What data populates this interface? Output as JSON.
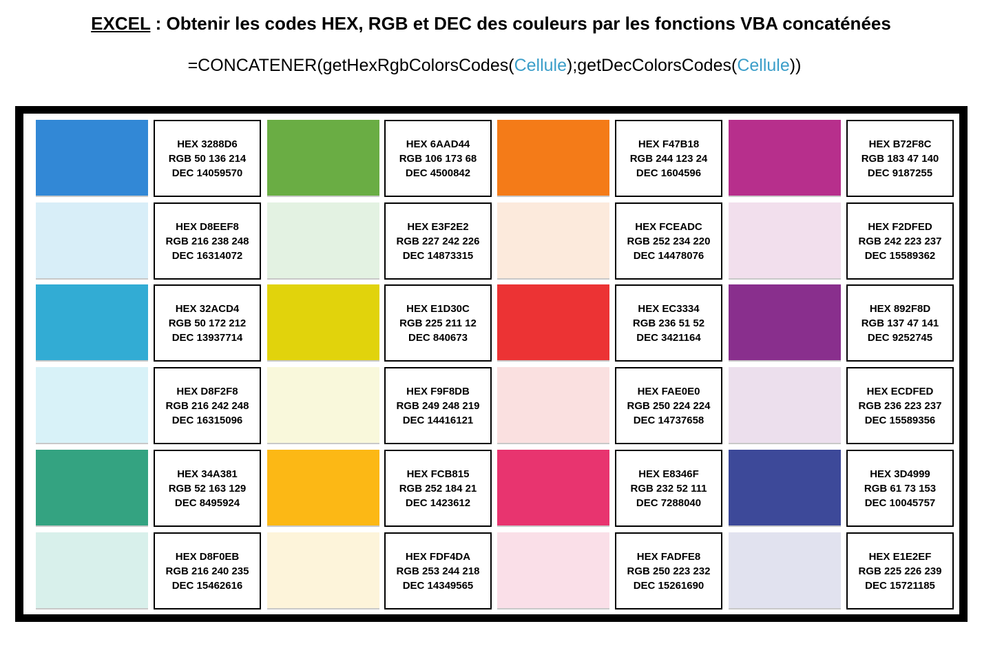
{
  "header": {
    "title_excel": "EXCEL",
    "title_rest": " : Obtenir les codes HEX, RGB et DEC des couleurs par les fonctions VBA concaténées"
  },
  "formula": {
    "part1": "=CONCATENER(getHexRgbColorsCodes(",
    "arg1": "Cellule",
    "part2": ");getDecColorsCodes(",
    "arg2": "Cellule",
    "part3": "))",
    "arg_color": "#3b9ec9"
  },
  "grid": [
    [
      {
        "swatch": "#3288D6",
        "hex": "HEX 3288D6",
        "rgb": "RGB 50 136 214",
        "dec": "DEC 14059570"
      },
      {
        "swatch": "#6AAD44",
        "hex": "HEX 6AAD44",
        "rgb": "RGB 106 173 68",
        "dec": "DEC 4500842"
      },
      {
        "swatch": "#F47B18",
        "hex": "HEX F47B18",
        "rgb": "RGB 244 123 24",
        "dec": "DEC 1604596"
      },
      {
        "swatch": "#B72F8C",
        "hex": "HEX B72F8C",
        "rgb": "RGB 183 47 140",
        "dec": "DEC 9187255"
      }
    ],
    [
      {
        "swatch": "#D8EEF8",
        "hex": "HEX D8EEF8",
        "rgb": "RGB 216 238 248",
        "dec": "DEC 16314072"
      },
      {
        "swatch": "#E3F2E2",
        "hex": "HEX E3F2E2",
        "rgb": "RGB 227 242 226",
        "dec": "DEC 14873315"
      },
      {
        "swatch": "#FCEADC",
        "hex": "HEX FCEADC",
        "rgb": "RGB 252 234 220",
        "dec": "DEC 14478076"
      },
      {
        "swatch": "#F2DFED",
        "hex": "HEX F2DFED",
        "rgb": "RGB 242 223 237",
        "dec": "DEC 15589362"
      }
    ],
    [
      {
        "swatch": "#32ACD4",
        "hex": "HEX 32ACD4",
        "rgb": "RGB 50 172 212",
        "dec": "DEC 13937714"
      },
      {
        "swatch": "#E1D30C",
        "hex": "HEX E1D30C",
        "rgb": "RGB 225 211 12",
        "dec": "DEC 840673"
      },
      {
        "swatch": "#EC3334",
        "hex": "HEX EC3334",
        "rgb": "RGB 236 51 52",
        "dec": "DEC 3421164"
      },
      {
        "swatch": "#892F8D",
        "hex": "HEX 892F8D",
        "rgb": "RGB 137 47 141",
        "dec": "DEC 9252745"
      }
    ],
    [
      {
        "swatch": "#D8F2F8",
        "hex": "HEX D8F2F8",
        "rgb": "RGB 216 242 248",
        "dec": "DEC 16315096"
      },
      {
        "swatch": "#F9F8DB",
        "hex": "HEX F9F8DB",
        "rgb": "RGB 249 248 219",
        "dec": "DEC 14416121"
      },
      {
        "swatch": "#FAE0E0",
        "hex": "HEX FAE0E0",
        "rgb": "RGB 250 224 224",
        "dec": "DEC 14737658"
      },
      {
        "swatch": "#ECDFED",
        "hex": "HEX ECDFED",
        "rgb": "RGB 236 223 237",
        "dec": "DEC 15589356"
      }
    ],
    [
      {
        "swatch": "#34A381",
        "hex": "HEX 34A381",
        "rgb": "RGB 52 163 129",
        "dec": "DEC 8495924"
      },
      {
        "swatch": "#FCB815",
        "hex": "HEX FCB815",
        "rgb": "RGB 252 184 21",
        "dec": "DEC 1423612"
      },
      {
        "swatch": "#E8346F",
        "hex": "HEX E8346F",
        "rgb": "RGB 232 52 111",
        "dec": "DEC 7288040"
      },
      {
        "swatch": "#3D4999",
        "hex": "HEX 3D4999",
        "rgb": "RGB 61 73 153",
        "dec": "DEC 10045757"
      }
    ],
    [
      {
        "swatch": "#D8F0EB",
        "hex": "HEX D8F0EB",
        "rgb": "RGB 216 240 235",
        "dec": "DEC 15462616"
      },
      {
        "swatch": "#FDF4DA",
        "hex": "HEX FDF4DA",
        "rgb": "RGB 253 244 218",
        "dec": "DEC 14349565"
      },
      {
        "swatch": "#FADFE8",
        "hex": "HEX FADFE8",
        "rgb": "RGB 250 223 232",
        "dec": "DEC 15261690"
      },
      {
        "swatch": "#E1E2EF",
        "hex": "HEX E1E2EF",
        "rgb": "RGB 225 226 239",
        "dec": "DEC 15721185"
      }
    ]
  ]
}
